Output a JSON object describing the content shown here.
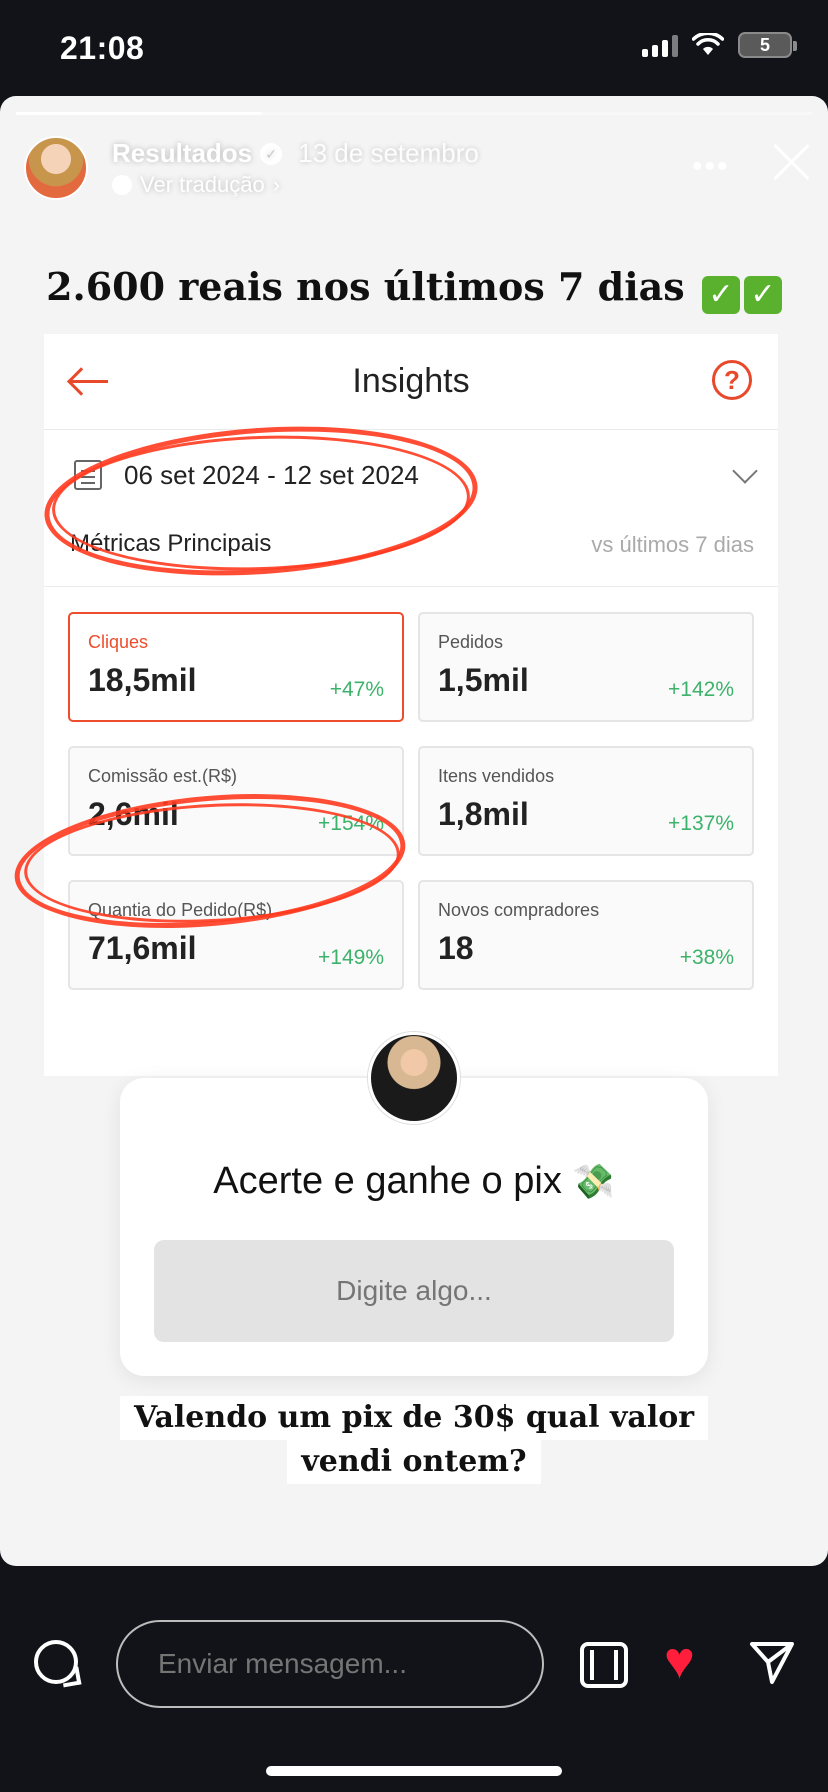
{
  "status": {
    "time": "21:08",
    "battery": "5"
  },
  "story": {
    "author": "Resultados",
    "date": "13 de setembro",
    "translate": "Ver tradução",
    "headline": "2.600 reais nos últimos 7 dias",
    "check_glyph": "✓"
  },
  "insights": {
    "title": "Insights",
    "help": "?",
    "date_range": "06 set 2024 - 12 set 2024",
    "metrics_title": "Métricas Principais",
    "vs_label": "vs últimos 7 dias",
    "metrics": [
      {
        "label": "Cliques",
        "value": "18,5mil",
        "change": "+47%"
      },
      {
        "label": "Pedidos",
        "value": "1,5mil",
        "change": "+142%"
      },
      {
        "label": "Comissão est.(R$)",
        "value": "2,6mil",
        "change": "+154%"
      },
      {
        "label": "Itens vendidos",
        "value": "1,8mil",
        "change": "+137%"
      },
      {
        "label": "Quantia do Pedido(R$)",
        "value": "71,6mil",
        "change": "+149%"
      },
      {
        "label": "Novos compradores",
        "value": "18",
        "change": "+38%"
      }
    ]
  },
  "quiz": {
    "question": "Acerte e ganhe o pix",
    "money_icon": "💸",
    "placeholder": "Digite algo..."
  },
  "caption": {
    "line1": "Valendo um pix de 30$ qual valor",
    "line2": "vendi ontem?"
  },
  "bottom": {
    "message_placeholder": "Enviar mensagem...",
    "heart_glyph": "♥"
  },
  "colors": {
    "accent": "#ee4d2d",
    "positive": "#3cb26a",
    "like": "#ff1f3d"
  }
}
